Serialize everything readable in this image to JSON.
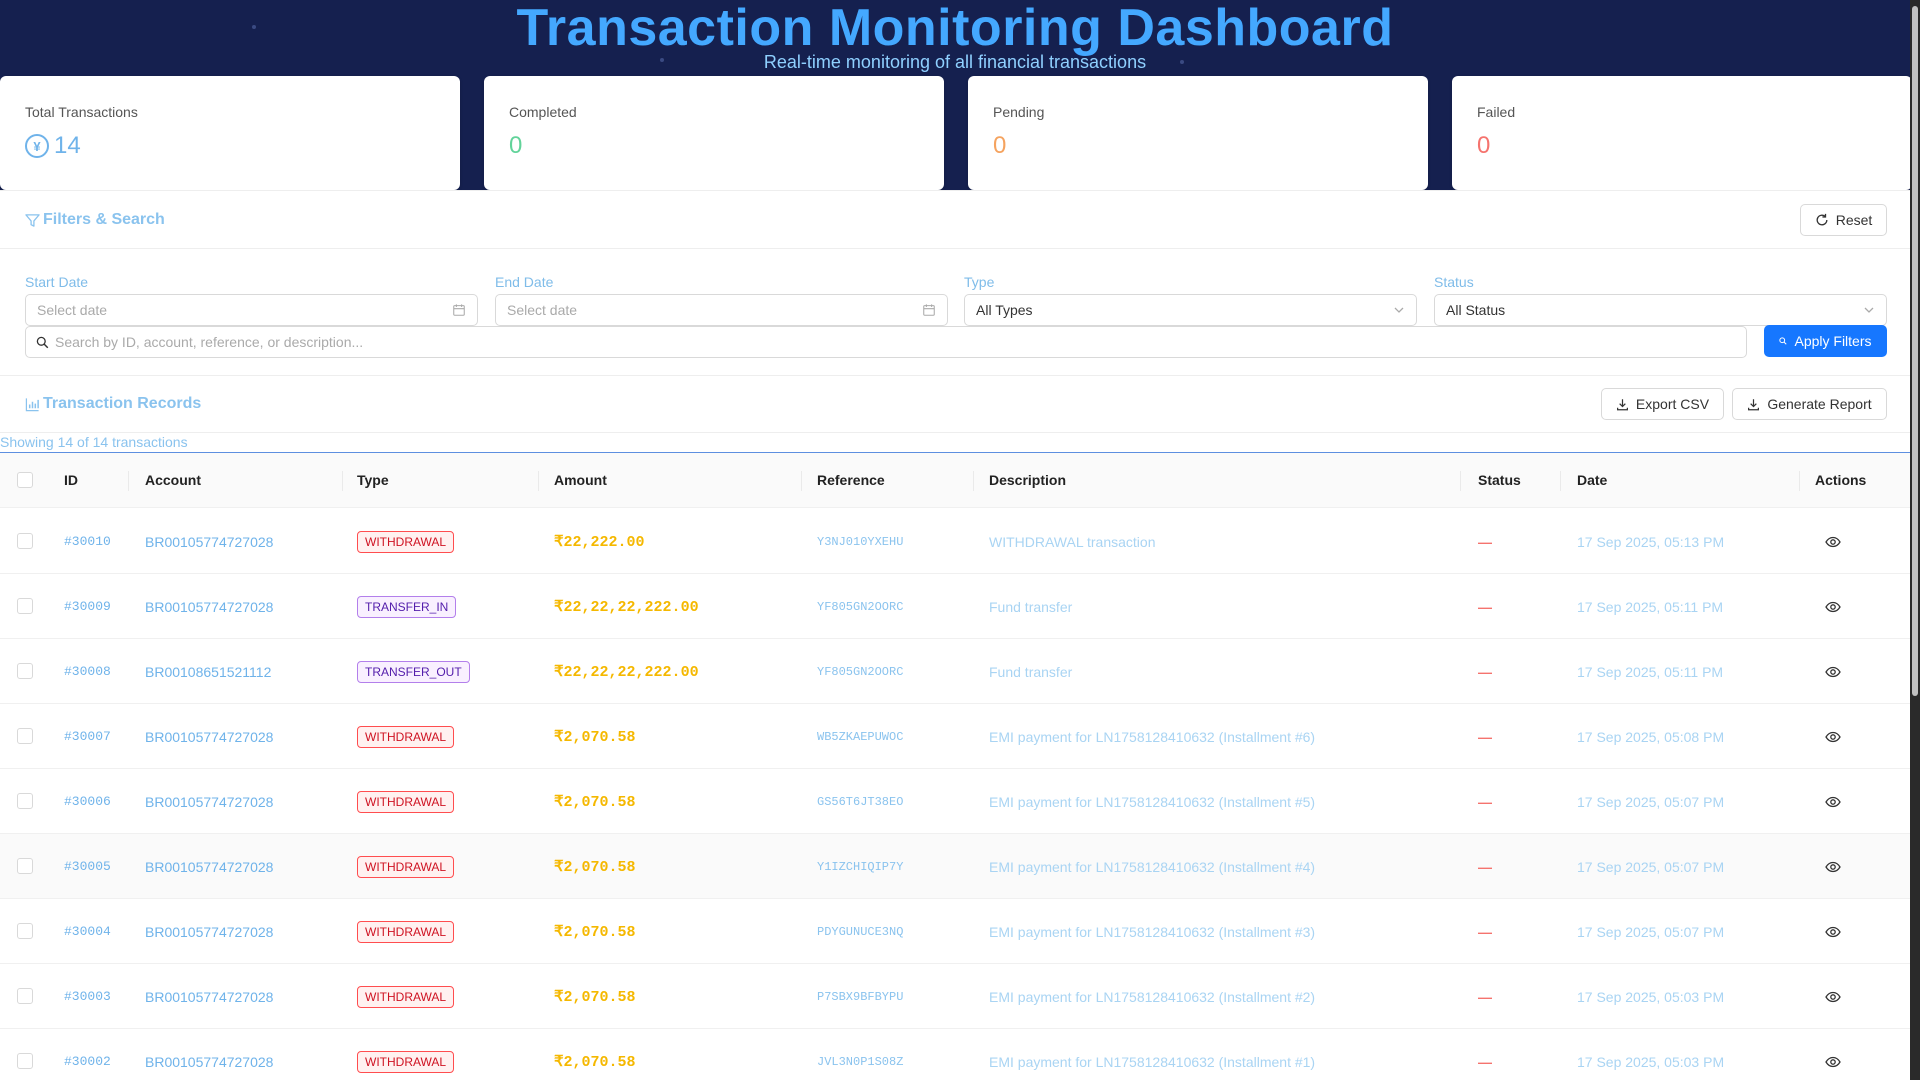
{
  "header": {
    "title": "Transaction Monitoring Dashboard",
    "subtitle": "Real-time monitoring of all financial transactions"
  },
  "stats": [
    {
      "label": "Total Transactions",
      "value": "14",
      "color": "#6fb3ea",
      "icon": "currency-yen-icon"
    },
    {
      "label": "Completed",
      "value": "0",
      "color": "#62d39a"
    },
    {
      "label": "Pending",
      "value": "0",
      "color": "#f5a35f"
    },
    {
      "label": "Failed",
      "value": "0",
      "color": "#f5736e"
    }
  ],
  "filters": {
    "title": "Filters & Search",
    "reset_label": "Reset",
    "start_date": {
      "label": "Start Date",
      "placeholder": "Select date"
    },
    "end_date": {
      "label": "End Date",
      "placeholder": "Select date"
    },
    "type": {
      "label": "Type",
      "value": "All Types"
    },
    "status": {
      "label": "Status",
      "value": "All Status"
    },
    "search": {
      "placeholder": "Search by ID, account, reference, or description..."
    },
    "apply_label": "Apply Filters"
  },
  "records": {
    "title": "Transaction Records",
    "export_label": "Export CSV",
    "report_label": "Generate Report",
    "showing": "Showing 14 of 14 transactions",
    "columns": [
      "ID",
      "Account",
      "Type",
      "Amount",
      "Reference",
      "Description",
      "Status",
      "Date",
      "Actions"
    ],
    "rows": [
      {
        "id": "#30010",
        "account": "BR00105774727028",
        "type": "WITHDRAWAL",
        "amount": "₹22,222.00",
        "reference": "Y3NJ010YXEHU",
        "description": "WITHDRAWAL transaction",
        "status": "—",
        "date": "17 Sep 2025, 05:13 PM"
      },
      {
        "id": "#30009",
        "account": "BR00105774727028",
        "type": "TRANSFER_IN",
        "amount": "₹22,22,22,222.00",
        "reference": "YF805GN2OORC",
        "description": "Fund transfer",
        "status": "—",
        "date": "17 Sep 2025, 05:11 PM"
      },
      {
        "id": "#30008",
        "account": "BR00108651521112",
        "type": "TRANSFER_OUT",
        "amount": "₹22,22,22,222.00",
        "reference": "YF805GN2OORC",
        "description": "Fund transfer",
        "status": "—",
        "date": "17 Sep 2025, 05:11 PM"
      },
      {
        "id": "#30007",
        "account": "BR00105774727028",
        "type": "WITHDRAWAL",
        "amount": "₹2,070.58",
        "reference": "WB5ZKAEPUWOC",
        "description": "EMI payment for LN1758128410632 (Installment #6)",
        "status": "—",
        "date": "17 Sep 2025, 05:08 PM"
      },
      {
        "id": "#30006",
        "account": "BR00105774727028",
        "type": "WITHDRAWAL",
        "amount": "₹2,070.58",
        "reference": "GS56T6JT38EO",
        "description": "EMI payment for LN1758128410632 (Installment #5)",
        "status": "—",
        "date": "17 Sep 2025, 05:07 PM"
      },
      {
        "id": "#30005",
        "account": "BR00105774727028",
        "type": "WITHDRAWAL",
        "amount": "₹2,070.58",
        "reference": "Y1IZCHIQIP7Y",
        "description": "EMI payment for LN1758128410632 (Installment #4)",
        "status": "—",
        "date": "17 Sep 2025, 05:07 PM"
      },
      {
        "id": "#30004",
        "account": "BR00105774727028",
        "type": "WITHDRAWAL",
        "amount": "₹2,070.58",
        "reference": "PDYGUNUCE3NQ",
        "description": "EMI payment for LN1758128410632 (Installment #3)",
        "status": "—",
        "date": "17 Sep 2025, 05:07 PM"
      },
      {
        "id": "#30003",
        "account": "BR00105774727028",
        "type": "WITHDRAWAL",
        "amount": "₹2,070.58",
        "reference": "P7SBX9BFBYPU",
        "description": "EMI payment for LN1758128410632 (Installment #2)",
        "status": "—",
        "date": "17 Sep 2025, 05:03 PM"
      },
      {
        "id": "#30002",
        "account": "BR00105774727028",
        "type": "WITHDRAWAL",
        "amount": "₹2,070.58",
        "reference": "JVL3N0P1S08Z",
        "description": "EMI payment for LN1758128410632 (Installment #1)",
        "status": "—",
        "date": "17 Sep 2025, 05:03 PM"
      }
    ]
  }
}
